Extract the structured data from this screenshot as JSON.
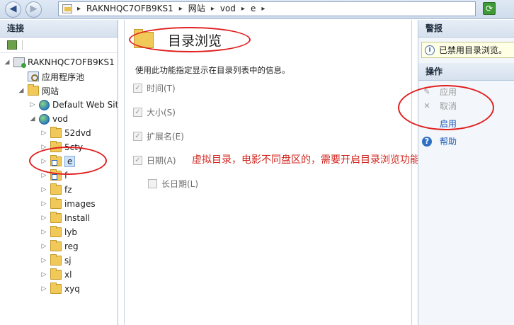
{
  "address_bar": {
    "back_icon": "back-arrow-icon",
    "forward_icon": "forward-arrow-icon",
    "breadcrumbs": [
      "RAKNHQC7OFB9KS1",
      "网站",
      "vod",
      "e"
    ],
    "separator": "▸",
    "refresh_icon": "refresh-icon"
  },
  "connections": {
    "title": "连接",
    "tree": [
      {
        "label": "RAKNHQC7OFB9KS1",
        "icon": "server-icon",
        "expander": "◢",
        "level": 0
      },
      {
        "label": "应用程序池",
        "icon": "app-pool-icon",
        "expander": "",
        "level": 1
      },
      {
        "label": "网站",
        "icon": "sites-folder-icon",
        "expander": "◢",
        "level": 1
      },
      {
        "label": "Default Web Site",
        "icon": "globe-icon",
        "expander": "▷",
        "level": 2
      },
      {
        "label": "vod",
        "icon": "globe-icon",
        "expander": "◢",
        "level": 2
      },
      {
        "label": "52dvd",
        "icon": "folder-icon",
        "expander": "▷",
        "level": 3
      },
      {
        "label": "5cty",
        "icon": "folder-icon",
        "expander": "▷",
        "level": 3
      },
      {
        "label": "e",
        "icon": "virtual-directory-icon",
        "expander": "▷",
        "level": 3,
        "selected": true
      },
      {
        "label": "f",
        "icon": "virtual-directory-icon",
        "expander": "▷",
        "level": 3
      },
      {
        "label": "fz",
        "icon": "folder-icon",
        "expander": "▷",
        "level": 3
      },
      {
        "label": "images",
        "icon": "folder-icon",
        "expander": "▷",
        "level": 3
      },
      {
        "label": "Install",
        "icon": "folder-icon",
        "expander": "▷",
        "level": 3
      },
      {
        "label": "lyb",
        "icon": "folder-icon",
        "expander": "▷",
        "level": 3
      },
      {
        "label": "reg",
        "icon": "folder-icon",
        "expander": "▷",
        "level": 3
      },
      {
        "label": "sj",
        "icon": "folder-icon",
        "expander": "▷",
        "level": 3
      },
      {
        "label": "xl",
        "icon": "folder-icon",
        "expander": "▷",
        "level": 3
      },
      {
        "label": "xyq",
        "icon": "folder-icon",
        "expander": "▷",
        "level": 3
      }
    ]
  },
  "main": {
    "title": "目录浏览",
    "description": "使用此功能指定显示在目录列表中的信息。",
    "options": [
      {
        "label": "时间(T)",
        "checked": true,
        "enabled": false
      },
      {
        "label": "大小(S)",
        "checked": true,
        "enabled": false
      },
      {
        "label": "扩展名(E)",
        "checked": true,
        "enabled": false
      },
      {
        "label": "日期(A)",
        "checked": true,
        "enabled": false
      },
      {
        "label": "长日期(L)",
        "checked": false,
        "enabled": false
      }
    ],
    "annotation": "虚拟目录，电影不同盘区的，需要开启目录浏览功能",
    "annotation_color": "#d1261f"
  },
  "actions": {
    "alerts_title": "警报",
    "alert_text": "已禁用目录浏览。",
    "actions_title": "操作",
    "items": [
      {
        "label": "应用",
        "enabled": false,
        "icon": "apply-icon"
      },
      {
        "label": "取消",
        "enabled": false,
        "icon": "cancel-icon"
      },
      {
        "label": "启用",
        "enabled": true,
        "icon": ""
      },
      {
        "label": "帮助",
        "enabled": true,
        "icon": "help-icon"
      }
    ]
  }
}
